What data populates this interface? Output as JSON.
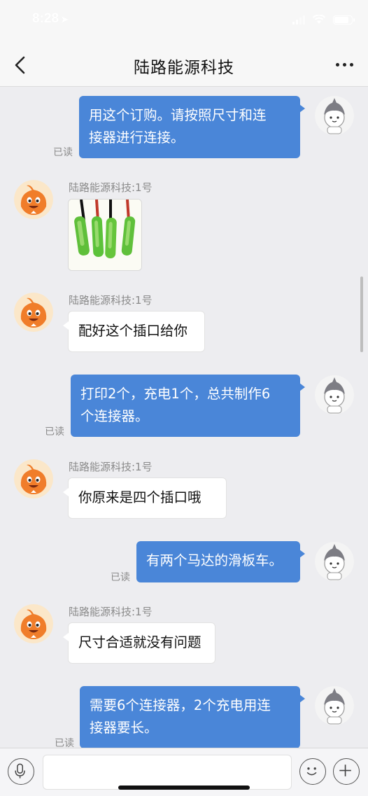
{
  "status_bar": {
    "time": "8:28"
  },
  "header": {
    "title": "陆路能源科技"
  },
  "messages": [
    {
      "text": "用这个订购。请按照尺寸和连接器进行连接。",
      "lines": [
        "用这个订购。请按照尺寸和连",
        "接器进行连接。"
      ],
      "read": "已读"
    },
    {
      "sender": "陆路能源科技:1号"
    },
    {
      "sender": "陆路能源科技:1号",
      "text": "配好这个插口给你"
    },
    {
      "text": "打印2个，充电1个，总共制作6个连接器。",
      "lines": [
        "打印2个，充电1个，总共制作6",
        "个连接器。"
      ],
      "read": "已读"
    },
    {
      "sender": "陆路能源科技:1号",
      "text": "你原来是四个插口哦"
    },
    {
      "text": "有两个马达的滑板车。",
      "read": "已读"
    },
    {
      "sender": "陆路能源科技:1号",
      "text": "尺寸合适就没有问题"
    },
    {
      "text": "需要6个连接器，2个充电用连接器要长。",
      "lines": [
        "需要6个连接器，2个充电用连",
        "接器要长。"
      ],
      "read": "已读"
    }
  ],
  "colors": {
    "outgoing_bubble": "#4a86d8",
    "incoming_bubble": "#ffffff",
    "background": "#ededf0"
  },
  "icons": [
    "back-icon",
    "more-icon",
    "microphone-icon",
    "emoji-icon",
    "plus-icon"
  ]
}
